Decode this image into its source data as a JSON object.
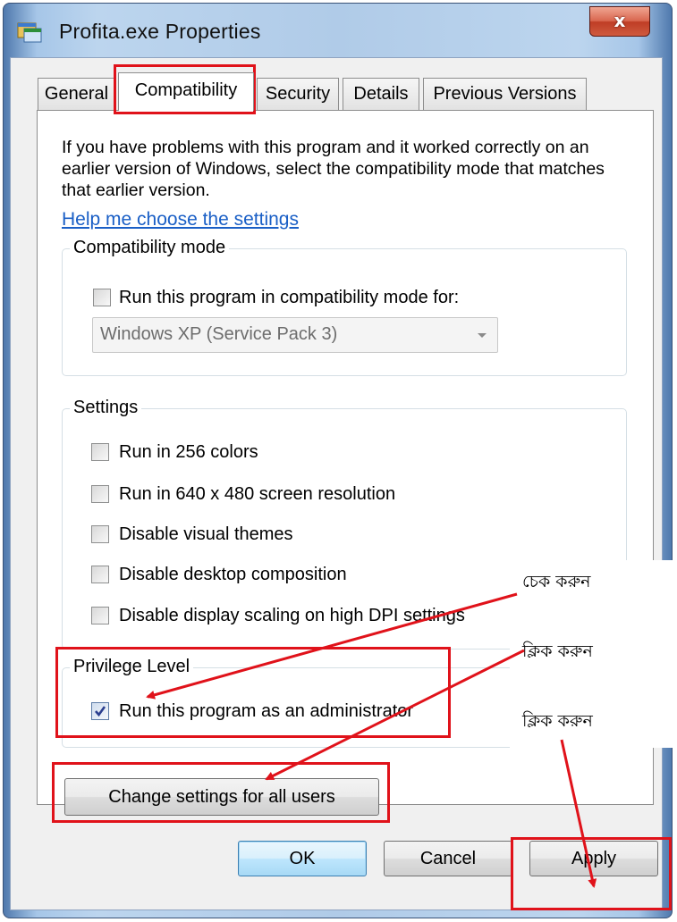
{
  "window": {
    "title": "Profita.exe Properties",
    "close_glyph": "x",
    "app_icon": "app-window-icon"
  },
  "tabs": [
    {
      "label": "General",
      "active": false
    },
    {
      "label": "Compatibility",
      "active": true
    },
    {
      "label": "Security",
      "active": false
    },
    {
      "label": "Details",
      "active": false
    },
    {
      "label": "Previous Versions",
      "active": false
    }
  ],
  "intro": {
    "text": "If you have problems with this program and it worked correctly on an earlier version of Windows, select the compatibility mode that matches that earlier version.",
    "help_link": "Help me choose the settings"
  },
  "compat_mode": {
    "legend": "Compatibility mode",
    "checkbox_label": "Run this program in compatibility mode for:",
    "checked": false,
    "select_value": "Windows XP (Service Pack 3)"
  },
  "settings": {
    "legend": "Settings",
    "items": [
      {
        "label": "Run in 256 colors",
        "checked": false
      },
      {
        "label": "Run in 640 x 480 screen resolution",
        "checked": false
      },
      {
        "label": "Disable visual themes",
        "checked": false
      },
      {
        "label": "Disable desktop composition",
        "checked": false
      },
      {
        "label": "Disable display scaling on high DPI settings",
        "checked": false
      }
    ]
  },
  "privilege": {
    "legend": "Privilege Level",
    "checkbox_label": "Run this program as an administrator",
    "checked": true
  },
  "change_all_users_label": "Change settings for all users",
  "footer": {
    "ok_label": "OK",
    "cancel_label": "Cancel",
    "apply_label": "Apply"
  },
  "annotations": {
    "note_check": "চেক করুন",
    "note_click_1": "ক্লিক করুন",
    "note_click_2": "ক্লিক করুন",
    "highlight_color": "#e0121a"
  }
}
